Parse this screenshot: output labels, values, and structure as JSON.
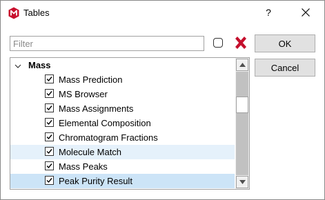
{
  "window": {
    "title": "Tables",
    "help_label": "?",
    "icon": "app-logo-icon"
  },
  "filter": {
    "value": "",
    "placeholder": "Filter"
  },
  "buttons": {
    "ok_label": "OK",
    "cancel_label": "Cancel"
  },
  "tree": {
    "group": {
      "label": "Mass",
      "expanded": true
    },
    "items": [
      {
        "label": "Mass Prediction",
        "checked": true
      },
      {
        "label": "MS Browser",
        "checked": true
      },
      {
        "label": "Mass Assignments",
        "checked": true
      },
      {
        "label": "Elemental Composition",
        "checked": true
      },
      {
        "label": "Chromatogram Fractions",
        "checked": true
      },
      {
        "label": "Molecule Match",
        "checked": true,
        "state": "hover"
      },
      {
        "label": "Mass Peaks",
        "checked": true
      },
      {
        "label": "Peak Purity Result",
        "checked": true,
        "state": "selected"
      }
    ]
  },
  "colors": {
    "hover_row": "#e5f1fb",
    "selected_row": "#cce4f7",
    "app_icon": "#c8102e",
    "clear_icon": "#c8102e"
  }
}
